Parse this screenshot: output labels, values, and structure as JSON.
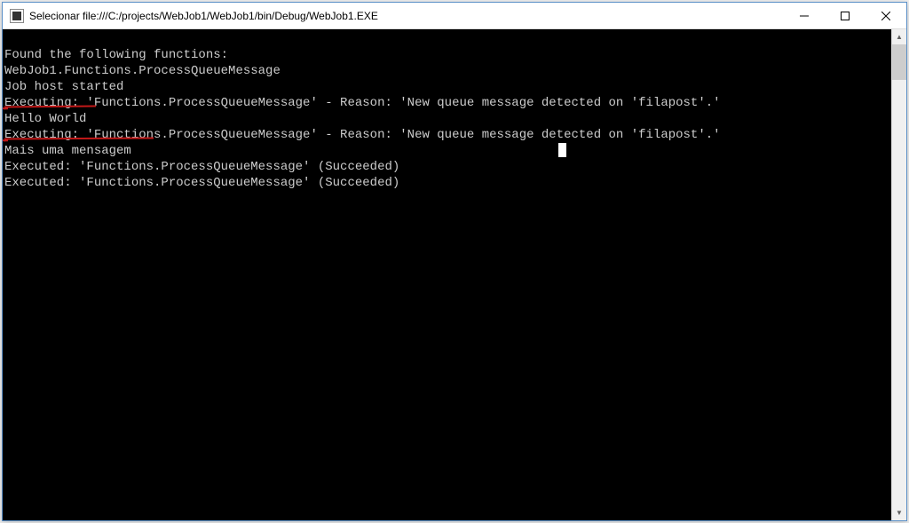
{
  "window": {
    "title": "Selecionar file:///C:/projects/WebJob1/WebJob1/bin/Debug/WebJob1.EXE"
  },
  "console": {
    "lines": [
      "Found the following functions:",
      "WebJob1.Functions.ProcessQueueMessage",
      "Job host started",
      "Executing: 'Functions.ProcessQueueMessage' - Reason: 'New queue message detected on 'filapost'.'",
      "Hello World",
      "Executing: 'Functions.ProcessQueueMessage' - Reason: 'New queue message detected on 'filapost'.'",
      "Mais uma mensagem",
      "Executed: 'Functions.ProcessQueueMessage' (Succeeded)",
      "Executed: 'Functions.ProcessQueueMessage' (Succeeded)"
    ]
  }
}
